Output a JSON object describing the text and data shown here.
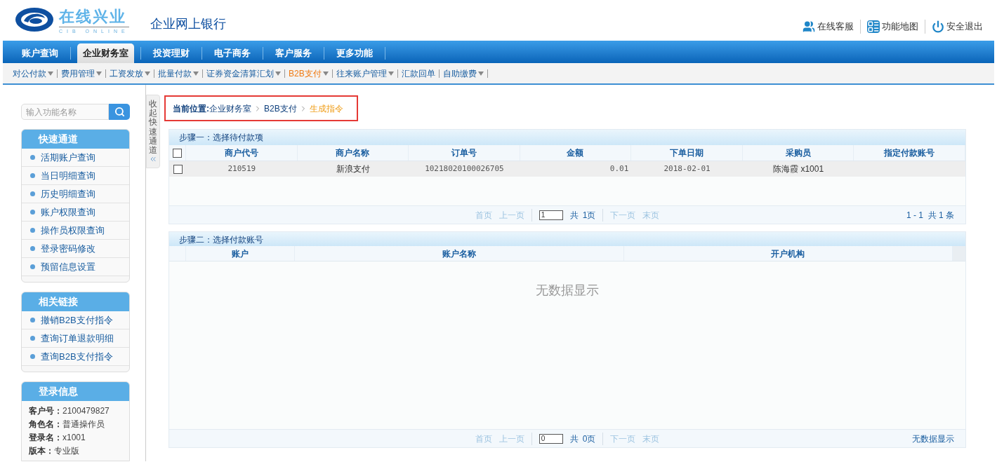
{
  "logo": {
    "title": "在线兴业",
    "subtitle": "CIB ONLINE",
    "product": "企业网上银行"
  },
  "top_links": [
    {
      "kind": "service",
      "label": "在线客服"
    },
    {
      "kind": "map",
      "label": "功能地图"
    },
    {
      "kind": "logout",
      "label": "安全退出"
    }
  ],
  "main_tabs": [
    {
      "label": "账户查询",
      "selected": false
    },
    {
      "label": "企业财务室",
      "selected": true
    },
    {
      "label": "投资理财",
      "selected": false
    },
    {
      "label": "电子商务",
      "selected": false
    },
    {
      "label": "客户服务",
      "selected": false
    },
    {
      "label": "更多功能",
      "selected": false
    }
  ],
  "sub_menu": [
    {
      "label": "对公付款",
      "dropdown": true,
      "selected": false
    },
    {
      "label": "费用管理",
      "dropdown": true,
      "selected": false
    },
    {
      "label": "工资发放",
      "dropdown": true,
      "selected": false
    },
    {
      "label": "批量付款",
      "dropdown": true,
      "selected": false
    },
    {
      "label": "证券资金清算汇划",
      "dropdown": true,
      "selected": false
    },
    {
      "label": "B2B支付",
      "dropdown": true,
      "selected": true
    },
    {
      "label": "往来账户管理",
      "dropdown": true,
      "selected": false
    },
    {
      "label": "汇款回单",
      "dropdown": false,
      "selected": false
    },
    {
      "label": "自助缴费",
      "dropdown": true,
      "selected": false
    }
  ],
  "search": {
    "placeholder": "输入功能名称"
  },
  "quick_access": {
    "title": "快速通道",
    "items": [
      "活期账户查询",
      "当日明细查询",
      "历史明细查询",
      "账户权限查询",
      "操作员权限查询",
      "登录密码修改",
      "预留信息设置"
    ]
  },
  "related_links": {
    "title": "相关链接",
    "items": [
      "撤销B2B支付指令",
      "查询订单退款明细",
      "查询B2B支付指令"
    ]
  },
  "login_info": {
    "title": "登录信息",
    "fields": [
      {
        "label": "客户号：",
        "value": "2100479827"
      },
      {
        "label": "角色名：",
        "value": "普通操作员"
      },
      {
        "label": "登录名：",
        "value": "x1001"
      },
      {
        "label": "版本：",
        "value": "专业版"
      }
    ]
  },
  "collapse_toggle": {
    "label": "收起快速通道"
  },
  "breadcrumb": {
    "label": "当前位置:",
    "items": [
      {
        "label": "企业财务室",
        "selected": false
      },
      {
        "label": "B2B支付",
        "selected": false
      },
      {
        "label": "生成指令",
        "selected": true
      }
    ]
  },
  "step1": {
    "title": "步骤一：选择待付款项",
    "header_checked": false,
    "columns": [
      "商户代号",
      "商户名称",
      "订单号",
      "金额",
      "下单日期",
      "采购员",
      "指定付款账号"
    ],
    "rows": [
      {
        "checked": false,
        "cells": [
          "210519",
          "新浪支付",
          "10218020100026705",
          "0.01",
          "2018-02-01",
          "陈海霞 x1001",
          ""
        ]
      }
    ],
    "pager": {
      "prev_links": [
        {
          "label": "首页",
          "disabled": true
        },
        {
          "label": "上一页",
          "disabled": true
        }
      ],
      "page_value": "1",
      "total_label": "共",
      "total_pages": "1页",
      "next_links": [
        {
          "label": "下一页",
          "disabled": true
        },
        {
          "label": "末页",
          "disabled": true
        }
      ],
      "summary": "1 - 1  共 1 条"
    }
  },
  "step2": {
    "title": "步骤二：选择付款账号",
    "columns": [
      "账户",
      "账户名称",
      "开户机构"
    ],
    "empty_text": "无数据显示",
    "pager": {
      "prev_links": [
        {
          "label": "首页",
          "disabled": true
        },
        {
          "label": "上一页",
          "disabled": true
        }
      ],
      "page_value": "0",
      "total_label": "共",
      "total_pages": "0页",
      "next_links": [
        {
          "label": "下一页",
          "disabled": true
        },
        {
          "label": "末页",
          "disabled": true
        }
      ],
      "summary": "无数据显示"
    }
  }
}
